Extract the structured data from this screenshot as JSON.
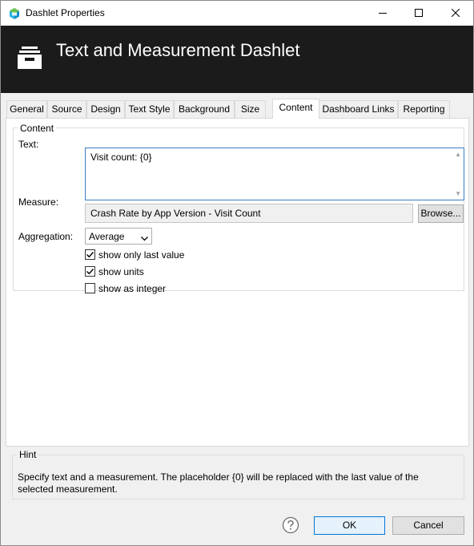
{
  "window": {
    "title": "Dashlet Properties",
    "icon": "app-logo-icon",
    "controls": [
      "minimize-icon",
      "maximize-icon",
      "close-icon"
    ]
  },
  "header": {
    "title": "Text and Measurement Dashlet",
    "icon": "inbox-tray-icon"
  },
  "tabs": [
    {
      "label": "General"
    },
    {
      "label": "Source"
    },
    {
      "label": "Design"
    },
    {
      "label": "Text Style"
    },
    {
      "label": "Background"
    },
    {
      "label": "Size"
    },
    {
      "label": "Content",
      "active": true
    },
    {
      "label": "Dashboard Links"
    },
    {
      "label": "Reporting"
    }
  ],
  "content": {
    "group_label": "Content",
    "text_label": "Text:",
    "text_value": "Visit count: {0}",
    "measure_label": "Measure:",
    "measure_value": "Crash Rate by App Version - Visit Count",
    "browse_label": "Browse...",
    "aggregation_label": "Aggregation:",
    "aggregation_value": "Average",
    "checkboxes": [
      {
        "label": "show only last value",
        "checked": true
      },
      {
        "label": "show units",
        "checked": true
      },
      {
        "label": "show as integer",
        "checked": false
      }
    ]
  },
  "hint": {
    "label": "Hint",
    "text": "Specify text and a measurement. The placeholder {0} will be replaced with the last value of the selected measurement."
  },
  "footer": {
    "ok_label": "OK",
    "cancel_label": "Cancel",
    "help_icon": "help-icon"
  },
  "colors": {
    "header_bg": "#1b1b1b",
    "focus_border": "#3a7bbf",
    "default_button_border": "#0078d7"
  }
}
